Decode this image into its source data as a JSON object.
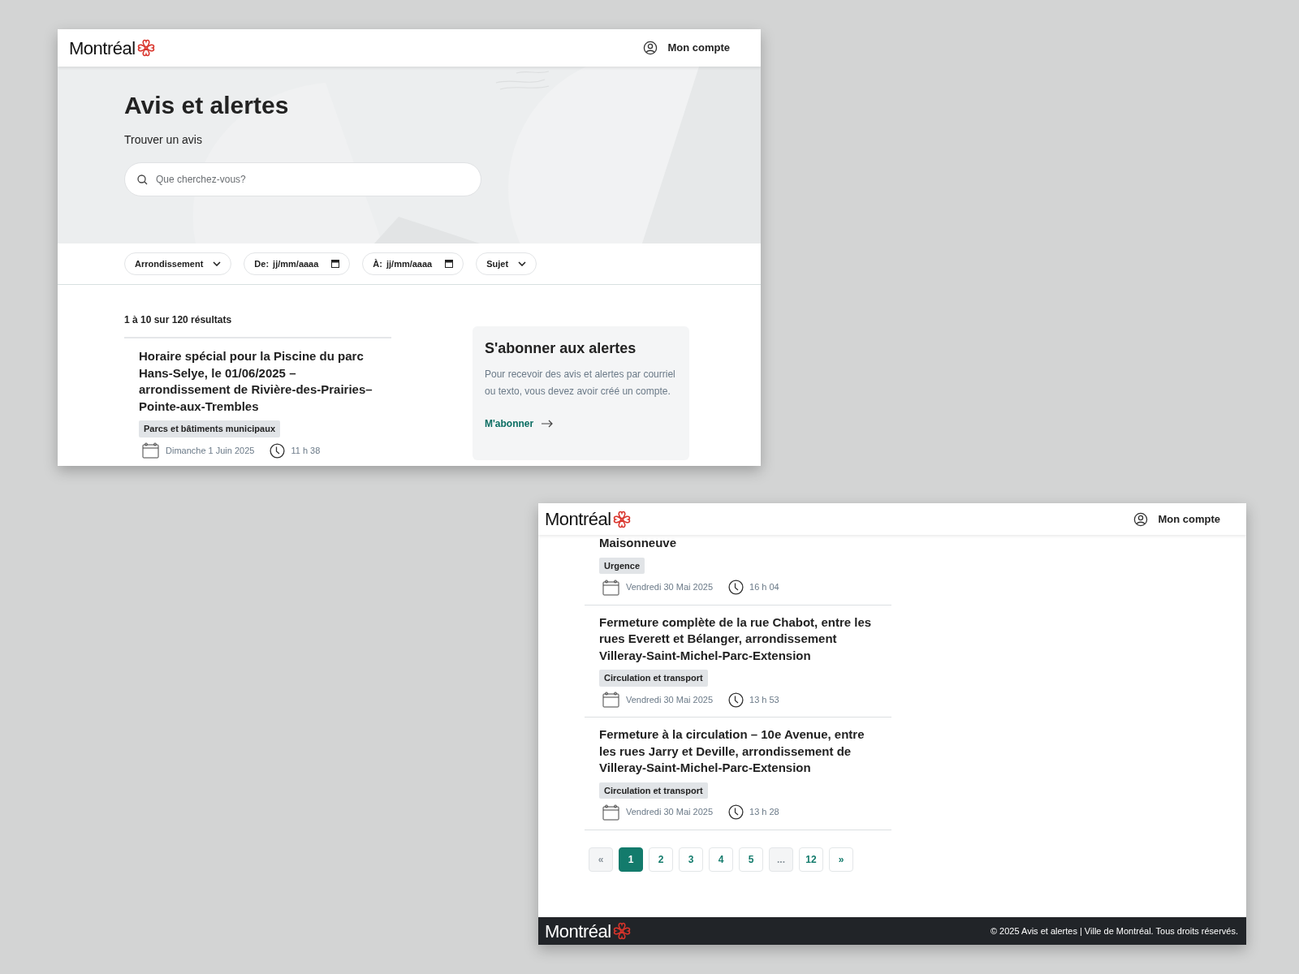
{
  "window_1": {
    "header": {
      "logo": "Montréal",
      "account": "Mon compte"
    },
    "hero": {
      "title": "Avis et alertes",
      "subtitle": "Trouver un avis",
      "search": {
        "placeholder": "Que cherchez-vous?"
      }
    },
    "filters": [
      {
        "kind": "dropdown",
        "label": "Arrondissement"
      },
      {
        "kind": "date",
        "label": "De:",
        "text": "jj/mm/aaaa"
      },
      {
        "kind": "date",
        "label": "À:",
        "text": "jj/mm/aaaa"
      },
      {
        "kind": "dropdown",
        "label": "Sujet"
      }
    ],
    "results_count": "1 à 10 sur 120 résultats",
    "notices": [
      {
        "title": "Horaire spécial pour la Piscine du parc Hans-Selye, le 01/06/2025 – arrondissement de Rivière-des-Prairies–Pointe-aux-Trembles",
        "tag": "Parcs et bâtiments municipaux",
        "date": "Dimanche 1 Juin 2025",
        "time": "11 h 38"
      }
    ],
    "subscribe": {
      "title": "S'abonner aux alertes",
      "text": "Pour recevoir des avis et alertes par courriel ou texto, vous devez avoir créé un compte.",
      "link": "M'abonner"
    }
  },
  "window_2": {
    "header": {
      "logo": "Montréal",
      "account": "Mon compte"
    },
    "notices": [
      {
        "title": "Maisonneuve",
        "tag": "Urgence",
        "date": "Vendredi 30 Mai 2025",
        "time": "16 h 04"
      },
      {
        "title": "Fermeture complète de la rue Chabot, entre les rues Everett et Bélanger, arrondissement Villeray-Saint-Michel-Parc-Extension",
        "tag": "Circulation et transport",
        "date": "Vendredi 30 Mai 2025",
        "time": "13 h 53"
      },
      {
        "title": "Fermeture à la circulation – 10e Avenue, entre les rues Jarry et Deville, arrondissement de Villeray-Saint-Michel-Parc-Extension",
        "tag": "Circulation et transport",
        "date": "Vendredi 30 Mai 2025",
        "time": "13 h 28"
      }
    ],
    "pagination": [
      {
        "label": "«",
        "selected": false,
        "disabled": true
      },
      {
        "label": "1",
        "selected": true,
        "disabled": false
      },
      {
        "label": "2",
        "selected": false,
        "disabled": false
      },
      {
        "label": "3",
        "selected": false,
        "disabled": false
      },
      {
        "label": "4",
        "selected": false,
        "disabled": false
      },
      {
        "label": "5",
        "selected": false,
        "disabled": false
      },
      {
        "label": "...",
        "selected": false,
        "disabled": true
      },
      {
        "label": "12",
        "selected": false,
        "disabled": false
      },
      {
        "label": "»",
        "selected": false,
        "disabled": false
      }
    ],
    "footer": {
      "logo": "Montréal",
      "copyright": "© 2025 Avis et alertes | Ville de Montréal. Tous droits réservés."
    }
  }
}
